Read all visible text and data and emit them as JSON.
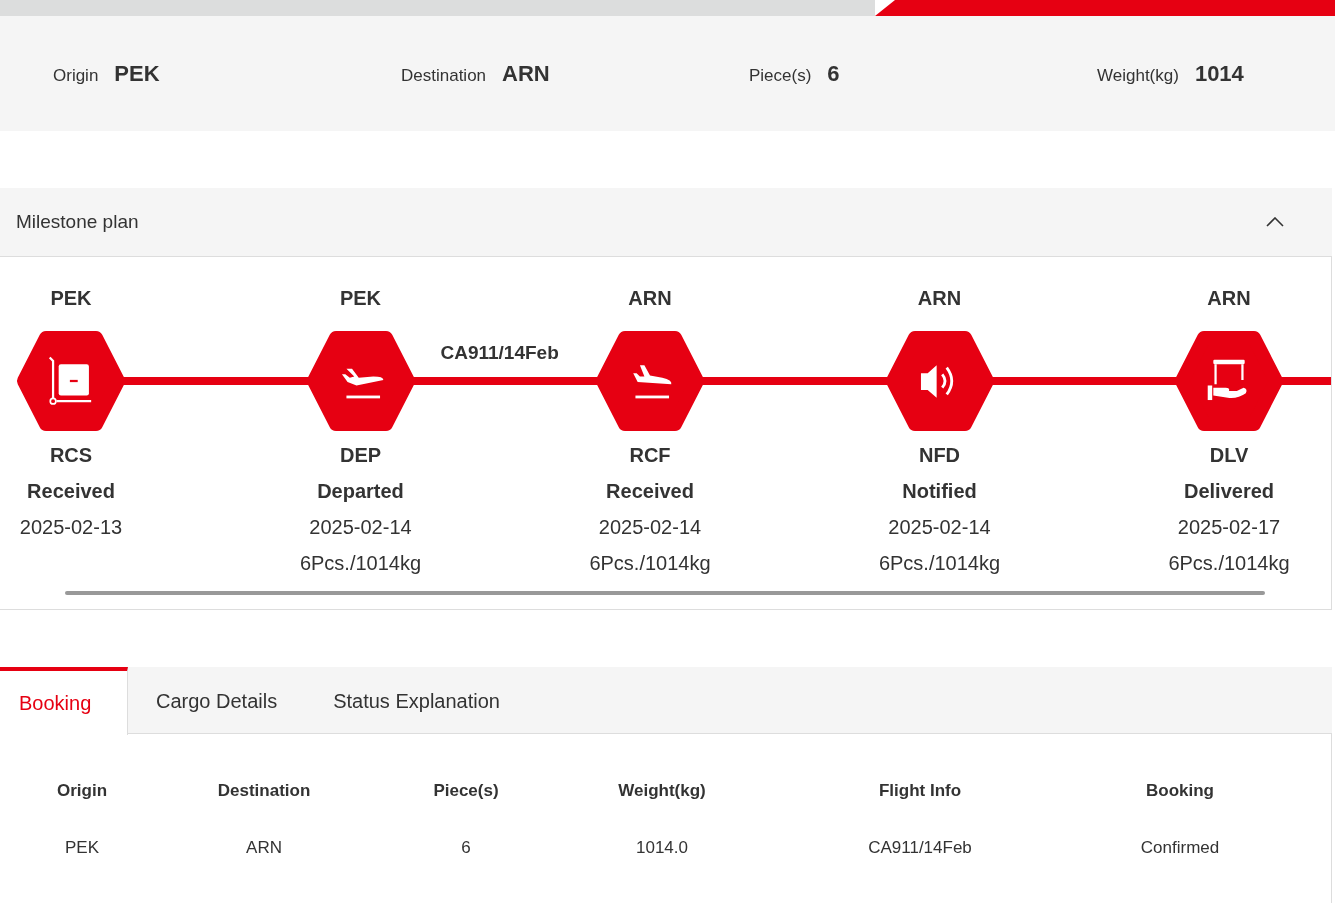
{
  "summary": [
    {
      "label": "Origin",
      "value": "PEK"
    },
    {
      "label": "Destination",
      "value": "ARN"
    },
    {
      "label": "Piece(s)",
      "value": "6"
    },
    {
      "label": "Weight(kg)",
      "value": "1014"
    }
  ],
  "milestone_plan": {
    "title": "Milestone plan",
    "expanded": true,
    "milestones": [
      {
        "location": "PEK",
        "kind": "cart",
        "code": "RCS",
        "status": "Received",
        "date": "2025-02-13"
      },
      {
        "location": "PEK",
        "kind": "takeoff",
        "code": "DEP",
        "status": "Departed",
        "date": "2025-02-14",
        "pieces": "6Pcs./1014kg",
        "flight": "CA911/14Feb"
      },
      {
        "location": "ARN",
        "kind": "landing",
        "code": "RCF",
        "status": "Received",
        "date": "2025-02-14",
        "pieces": "6Pcs./1014kg"
      },
      {
        "location": "ARN",
        "kind": "speaker",
        "code": "NFD",
        "status": "Notified",
        "date": "2025-02-14",
        "pieces": "6Pcs./1014kg"
      },
      {
        "location": "ARN",
        "kind": "delivery",
        "code": "DLV",
        "status": "Delivered",
        "date": "2025-02-17",
        "pieces": "6Pcs./1014kg"
      }
    ]
  },
  "tabs": [
    {
      "label": "Booking",
      "selected": true
    },
    {
      "label": "Cargo Details",
      "selected": false
    },
    {
      "label": "Status Explanation",
      "selected": false
    }
  ],
  "table": {
    "columns": [
      "Origin",
      "Destination",
      "Piece(s)",
      "Weight(kg)",
      "Flight Info",
      "Booking"
    ],
    "rows": [
      [
        "PEK",
        "ARN",
        "6",
        "1014.0",
        "CA911/14Feb",
        "Confirmed"
      ]
    ]
  }
}
